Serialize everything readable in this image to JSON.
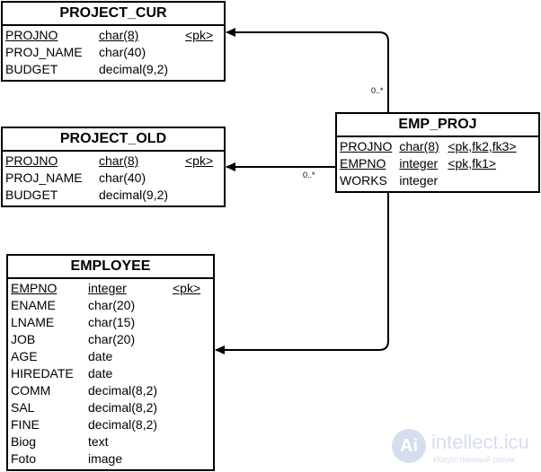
{
  "entities": {
    "project_cur": {
      "title": "PROJECT_CUR",
      "rows": [
        {
          "name": "PROJNO",
          "type": "char(8)",
          "key": "<pk>",
          "underline": true
        },
        {
          "name": "PROJ_NAME",
          "type": "char(40)",
          "key": ""
        },
        {
          "name": "BUDGET",
          "type": "decimal(9,2)",
          "key": ""
        }
      ]
    },
    "project_old": {
      "title": "PROJECT_OLD",
      "rows": [
        {
          "name": "PROJNO",
          "type": "char(8)",
          "key": "<pk>",
          "underline": true
        },
        {
          "name": "PROJ_NAME",
          "type": "char(40)",
          "key": ""
        },
        {
          "name": "BUDGET",
          "type": "decimal(9,2)",
          "key": ""
        }
      ]
    },
    "emp_proj": {
      "title": "EMP_PROJ",
      "rows": [
        {
          "name": "PROJNO",
          "type": "char(8)",
          "key": "<pk,fk2,fk3>",
          "underline": true
        },
        {
          "name": "EMPNO",
          "type": "integer",
          "key": "<pk,fk1>",
          "underline": true
        },
        {
          "name": "WORKS",
          "type": "integer",
          "key": ""
        }
      ]
    },
    "employee": {
      "title": "EMPLOYEE",
      "rows": [
        {
          "name": "EMPNO",
          "type": "integer",
          "key": "<pk>",
          "underline": true
        },
        {
          "name": "ENAME",
          "type": "char(20)",
          "key": ""
        },
        {
          "name": "LNAME",
          "type": "char(15)",
          "key": ""
        },
        {
          "name": "JOB",
          "type": "char(20)",
          "key": ""
        },
        {
          "name": "AGE",
          "type": "date",
          "key": ""
        },
        {
          "name": "HIREDATE",
          "type": "date",
          "key": ""
        },
        {
          "name": "COMM",
          "type": "decimal(8,2)",
          "key": ""
        },
        {
          "name": "SAL",
          "type": "decimal(8,2)",
          "key": ""
        },
        {
          "name": "FINE",
          "type": "decimal(8,2)",
          "key": ""
        },
        {
          "name": "Biog",
          "type": "text",
          "key": ""
        },
        {
          "name": "Foto",
          "type": "image",
          "key": ""
        }
      ]
    }
  },
  "relations": [
    {
      "from": "emp_proj",
      "to": "project_cur",
      "multiplicity": "0..*"
    },
    {
      "from": "emp_proj",
      "to": "project_old",
      "multiplicity": "0..*"
    },
    {
      "from": "emp_proj",
      "to": "employee",
      "multiplicity": ""
    }
  ],
  "watermark": {
    "logo": "Ai",
    "text": "intellect.icu",
    "subtext": "Искусственный разум"
  }
}
